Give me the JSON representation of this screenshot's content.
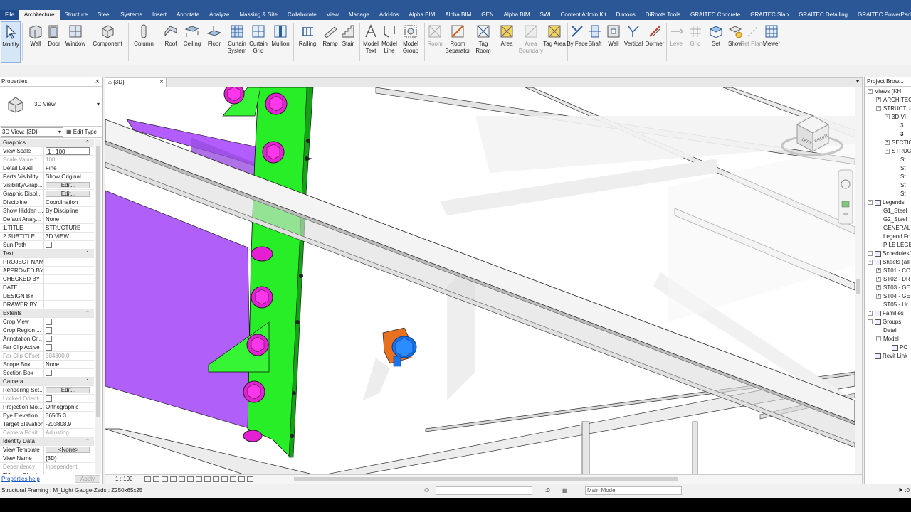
{
  "ribbon_tabs": [
    "File",
    "Architecture",
    "Structure",
    "Steel",
    "Systems",
    "Insert",
    "Annotate",
    "Analyze",
    "Massing & Site",
    "Collaborate",
    "View",
    "Manage",
    "Add-Ins",
    "Alpha BIM",
    "Alpha BIM",
    "GEN",
    "Alpha BIM",
    "SWI",
    "Content Admin Kit",
    "Dimoos",
    "DiRoots Tools",
    "GRAITEC Concrete",
    "GRAITEC Slab",
    "GRAITEC Detailing",
    "GRAITEC PowerPack"
  ],
  "ribbon_buttons": {
    "modify": "Modify",
    "wall": "Wall",
    "door": "Door",
    "window": "Window",
    "component": "Component",
    "column": "Column",
    "roof": "Roof",
    "ceiling": "Ceiling",
    "floor": "Floor",
    "curtain_system": "Curtain System",
    "curtain_grid": "Curtain Grid",
    "mullion": "Mullion",
    "railing": "Railing",
    "ramp": "Ramp",
    "stair": "Stair",
    "model_text": "Model Text",
    "model_line": "Model Line",
    "model_group": "Model Group",
    "room": "Room",
    "room_separator": "Room Separator",
    "tag_room": "Tag Room",
    "area": "Area",
    "area_boundary": "Area Boundary",
    "tag_area": "Tag Area",
    "by_face": "By Face",
    "shaft": "Shaft",
    "wall_opening": "Wall",
    "vertical": "Vertical",
    "dormer": "Dormer",
    "level": "Level",
    "grid": "Grid",
    "set": "Set",
    "show": "Show",
    "ref_plane": "Ref Plane",
    "viewer": "Viewer"
  },
  "properties": {
    "title": "Properties",
    "type_name": "3D View",
    "view_selector": "3D View: {3D}",
    "edit_type": "Edit Type",
    "rows": [
      {
        "group": "Graphics"
      },
      {
        "k": "View Scale",
        "v": "1 : 100",
        "style": "boxed"
      },
      {
        "k": "Scale Value   1:",
        "v": "100",
        "dim": true
      },
      {
        "k": "Detail Level",
        "v": "Fine"
      },
      {
        "k": "Parts Visibility",
        "v": "Show Original"
      },
      {
        "k": "Visibility/Grap...",
        "v": "Edit...",
        "style": "btn"
      },
      {
        "k": "Graphic Displ...",
        "v": "Edit...",
        "style": "btn"
      },
      {
        "k": "Discipline",
        "v": "Coordination"
      },
      {
        "k": "Show Hidden ...",
        "v": "By Discipline"
      },
      {
        "k": "Default Analy...",
        "v": "None"
      },
      {
        "k": "1.TITLE",
        "v": "STRUCTURE"
      },
      {
        "k": "2.SUBTITLE",
        "v": "3D VIEW"
      },
      {
        "k": "Sun Path",
        "v": "",
        "style": "cb"
      },
      {
        "group": "Text"
      },
      {
        "k": "PROJECT NAME",
        "v": ""
      },
      {
        "k": "APPROVED BY",
        "v": ""
      },
      {
        "k": "CHECKED BY",
        "v": ""
      },
      {
        "k": "DATE",
        "v": ""
      },
      {
        "k": "DESIGN BY",
        "v": ""
      },
      {
        "k": "DRAWER BY",
        "v": ""
      },
      {
        "group": "Extents"
      },
      {
        "k": "Crop View",
        "v": "",
        "style": "cb"
      },
      {
        "k": "Crop Region ...",
        "v": "",
        "style": "cb"
      },
      {
        "k": "Annotation Cr...",
        "v": "",
        "style": "cb"
      },
      {
        "k": "Far Clip Active",
        "v": "",
        "style": "cb"
      },
      {
        "k": "Far Clip Offset",
        "v": "304800.0",
        "dim": true
      },
      {
        "k": "Scope Box",
        "v": "None"
      },
      {
        "k": "Section Box",
        "v": "",
        "style": "cb"
      },
      {
        "group": "Camera"
      },
      {
        "k": "Rendering Set...",
        "v": "Edit...",
        "style": "btn"
      },
      {
        "k": "Locked Orient...",
        "v": "",
        "style": "cb",
        "dim": true
      },
      {
        "k": "Projection Mo...",
        "v": "Orthographic"
      },
      {
        "k": "Eye Elevation",
        "v": "36505.3"
      },
      {
        "k": "Target Elevation",
        "v": "-203808.9"
      },
      {
        "k": "Camera Positi...",
        "v": "Adjusting",
        "dim": true
      },
      {
        "group": "Identity Data"
      },
      {
        "k": "View Template",
        "v": "<None>",
        "style": "btn"
      },
      {
        "k": "View Name",
        "v": "{3D}"
      },
      {
        "k": "Dependency",
        "v": "Independent",
        "dim": true
      },
      {
        "k": "Title on Sheet",
        "v": ""
      }
    ],
    "help_link": "Properties help",
    "apply": "Apply"
  },
  "view": {
    "tab_label": "{3D}",
    "scale": "1 : 100",
    "cube_left": "LEFT",
    "cube_front": "FRONT"
  },
  "browser": {
    "title": "Project Brow...",
    "items": [
      {
        "label": "Views (KH",
        "indent": 0,
        "exp": "−"
      },
      {
        "label": "ARCHITEC",
        "indent": 1,
        "exp": "+"
      },
      {
        "label": "STRUCTUR",
        "indent": 1,
        "exp": "−"
      },
      {
        "label": "3D VI",
        "indent": 2,
        "exp": "−"
      },
      {
        "label": "3",
        "indent": 3,
        "exp": ""
      },
      {
        "label": "3",
        "indent": 3,
        "exp": "",
        "bold": true
      },
      {
        "label": "SECTIO",
        "indent": 2,
        "exp": "+"
      },
      {
        "label": "STRUC",
        "indent": 2,
        "exp": "−"
      },
      {
        "label": "St",
        "indent": 3,
        "exp": ""
      },
      {
        "label": "St",
        "indent": 3,
        "exp": ""
      },
      {
        "label": "St",
        "indent": 3,
        "exp": ""
      },
      {
        "label": "St",
        "indent": 3,
        "exp": ""
      },
      {
        "label": "St",
        "indent": 3,
        "exp": ""
      },
      {
        "label": "Legends",
        "indent": 0,
        "exp": "−",
        "icon": true
      },
      {
        "label": "G1_Steel",
        "indent": 1,
        "exp": ""
      },
      {
        "label": "G2_Steel",
        "indent": 1,
        "exp": ""
      },
      {
        "label": "GENERAL",
        "indent": 1,
        "exp": ""
      },
      {
        "label": "Legend Fo",
        "indent": 1,
        "exp": ""
      },
      {
        "label": "PILE LEGE",
        "indent": 1,
        "exp": ""
      },
      {
        "label": "Schedules/",
        "indent": 0,
        "exp": "+",
        "icon": true
      },
      {
        "label": "Sheets (all",
        "indent": 0,
        "exp": "−",
        "icon": true
      },
      {
        "label": "ST01 - CO",
        "indent": 1,
        "exp": "+"
      },
      {
        "label": "ST02 - DR",
        "indent": 1,
        "exp": "+"
      },
      {
        "label": "ST03 - GE",
        "indent": 1,
        "exp": "+"
      },
      {
        "label": "ST04 - GE",
        "indent": 1,
        "exp": "+"
      },
      {
        "label": "ST05 - Ur",
        "indent": 1,
        "exp": ""
      },
      {
        "label": "Families",
        "indent": 0,
        "exp": "+",
        "icon": true
      },
      {
        "label": "Groups",
        "indent": 0,
        "exp": "−",
        "icon": true
      },
      {
        "label": "Detail",
        "indent": 1,
        "exp": ""
      },
      {
        "label": "Model",
        "indent": 1,
        "exp": "−"
      },
      {
        "label": "PC",
        "indent": 2,
        "exp": "",
        "icon": true
      },
      {
        "label": "Revit Link",
        "indent": 0,
        "exp": "",
        "icon": true
      }
    ]
  },
  "status": {
    "message": "Structural Framing : M_Light Gauge-Zeds : Z250x65x25",
    "zero": ":0",
    "model": "Main Model",
    "filter": ":0"
  }
}
